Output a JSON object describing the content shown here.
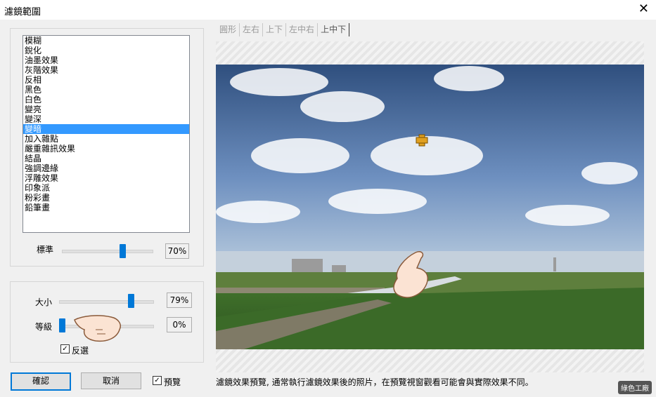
{
  "window": {
    "title": "濾鏡範圍",
    "close_glyph": "✕"
  },
  "filters": {
    "items": [
      "模糊",
      "銳化",
      "油墨效果",
      "灰階效果",
      "反相",
      "黑色",
      "白色",
      "變亮",
      "變深",
      "變暗",
      "加入雜點",
      "嚴重雜訊效果",
      "結晶",
      "強調邊緣",
      "浮雕效果",
      "印象派",
      "粉彩畫",
      "鉛筆畫"
    ],
    "selected_index": 9
  },
  "strength": {
    "label": "標準",
    "value": "70%",
    "level": 0.7
  },
  "size": {
    "label": "大小",
    "value": "79%",
    "level": 0.79
  },
  "grade": {
    "label": "等級",
    "value": "0%",
    "level": 0.0
  },
  "invert": {
    "label": "反選",
    "checked": true,
    "mark": "✓"
  },
  "buttons": {
    "ok": "確認",
    "cancel": "取消"
  },
  "preview_toggle": {
    "label": "預覽",
    "checked": true,
    "mark": "✓"
  },
  "tabs": [
    {
      "label": "圓形",
      "active": false
    },
    {
      "label": "左右",
      "active": false
    },
    {
      "label": "上下",
      "active": false
    },
    {
      "label": "左中右",
      "active": false
    },
    {
      "label": "上中下",
      "active": true
    }
  ],
  "caption": "濾鏡效果預覽, 通常執行濾鏡效果後的照片，在預覽視窗觀看可能會與實際效果不同。",
  "watermark": "綠色工廠",
  "colors": {
    "accent": "#0078d7",
    "selection": "#3399ff",
    "crosshair": "#e0a020"
  }
}
